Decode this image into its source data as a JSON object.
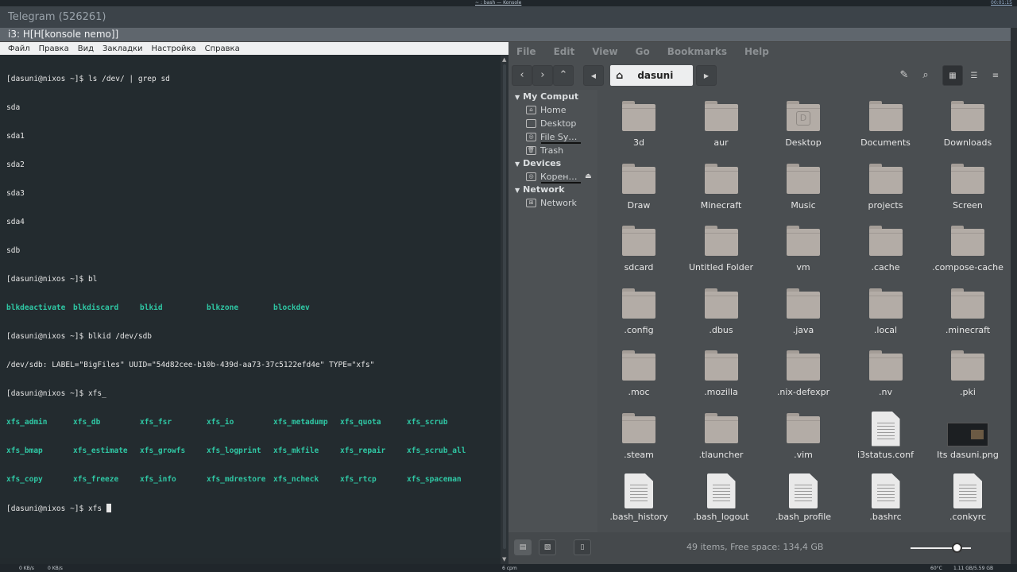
{
  "topbar": {
    "window_title": "~ : bash — Konsole",
    "clock": "00:01:15"
  },
  "telegram": {
    "title": "Telegram (526261)"
  },
  "i3": {
    "title": "i3: H[H[konsole nemo]]"
  },
  "konsole": {
    "menu": [
      "Файл",
      "Правка",
      "Вид",
      "Закладки",
      "Настройка",
      "Справка"
    ],
    "lines": [
      "[dasuni@nixos ~]$ ls /dev/ | grep sd",
      "sda",
      "sda1",
      "sda2",
      "sda3",
      "sda4",
      "sdb",
      "[dasuni@nixos ~]$ bl"
    ],
    "bl_completions": [
      "blkdeactivate",
      "blkdiscard",
      "blkid",
      "blkzone",
      "blockdev"
    ],
    "lines2": [
      "[dasuni@nixos ~]$ blkid /dev/sdb",
      "/dev/sdb: LABEL=\"BigFiles\" UUID=\"54d82cee-b10b-439d-aa73-37c5122efd4e\" TYPE=\"xfs\"",
      "[dasuni@nixos ~]$ xfs_"
    ],
    "xfs_completions": [
      [
        "xfs_admin",
        "xfs_db",
        "xfs_fsr",
        "xfs_io",
        "xfs_metadump",
        "xfs_quota",
        "xfs_scrub"
      ],
      [
        "xfs_bmap",
        "xfs_estimate",
        "xfs_growfs",
        "xfs_logprint",
        "xfs_mkfile",
        "xfs_repair",
        "xfs_scrub_all"
      ],
      [
        "xfs_copy",
        "xfs_freeze",
        "xfs_info",
        "xfs_mdrestore",
        "xfs_ncheck",
        "xfs_rtcp",
        "xfs_spaceman"
      ]
    ],
    "prompt_line": "[dasuni@nixos ~]$ xfs "
  },
  "nemo": {
    "menu": [
      "File",
      "Edit",
      "View",
      "Go",
      "Bookmarks",
      "Help"
    ],
    "path": "dasuni",
    "sidebar": {
      "my_computer": "My Comput",
      "devices": "Devices",
      "network": "Network",
      "items": [
        "Home",
        "Desktop",
        "File Sy…",
        "Trash"
      ],
      "device_items": [
        "Корен…"
      ],
      "network_items": [
        "Network"
      ]
    },
    "files": [
      {
        "name": "3d",
        "kind": "folder"
      },
      {
        "name": "aur",
        "kind": "folder"
      },
      {
        "name": "Desktop",
        "kind": "desktop"
      },
      {
        "name": "Documents",
        "kind": "folder"
      },
      {
        "name": "Downloads",
        "kind": "folder"
      },
      {
        "name": "Draw",
        "kind": "folder"
      },
      {
        "name": "Minecraft",
        "kind": "folder"
      },
      {
        "name": "Music",
        "kind": "folder"
      },
      {
        "name": "projects",
        "kind": "folder"
      },
      {
        "name": "Screen",
        "kind": "folder"
      },
      {
        "name": "sdcard",
        "kind": "folder"
      },
      {
        "name": "Untitled Folder",
        "kind": "folder"
      },
      {
        "name": "vm",
        "kind": "folder"
      },
      {
        "name": ".cache",
        "kind": "folder"
      },
      {
        "name": ".compose-cache",
        "kind": "folder"
      },
      {
        "name": ".config",
        "kind": "folder"
      },
      {
        "name": ".dbus",
        "kind": "folder"
      },
      {
        "name": ".java",
        "kind": "folder"
      },
      {
        "name": ".local",
        "kind": "folder"
      },
      {
        "name": ".minecraft",
        "kind": "folder"
      },
      {
        "name": ".moc",
        "kind": "folder"
      },
      {
        "name": ".mozilla",
        "kind": "folder"
      },
      {
        "name": ".nix-defexpr",
        "kind": "folder"
      },
      {
        "name": ".nv",
        "kind": "folder"
      },
      {
        "name": ".pki",
        "kind": "folder"
      },
      {
        "name": ".steam",
        "kind": "folder"
      },
      {
        "name": ".tlauncher",
        "kind": "folder"
      },
      {
        "name": ".vim",
        "kind": "folder"
      },
      {
        "name": "i3status.conf",
        "kind": "doc"
      },
      {
        "name": "Its dasuni.png",
        "kind": "image"
      },
      {
        "name": ".bash_history",
        "kind": "doc"
      },
      {
        "name": ".bash_logout",
        "kind": "doc"
      },
      {
        "name": ".bash_profile",
        "kind": "doc"
      },
      {
        "name": ".bashrc",
        "kind": "doc"
      },
      {
        "name": ".conkyrc",
        "kind": "doc"
      }
    ],
    "status": "49 items, Free space: 134,4 GB",
    "zoom_level": 0.77
  },
  "bottombar": {
    "net_down": "0 KB/s",
    "net_up": "0 KB/s",
    "cpu": "6 cpm",
    "temp": "60°C",
    "mem": "1.11 GB/5.59 GB"
  }
}
